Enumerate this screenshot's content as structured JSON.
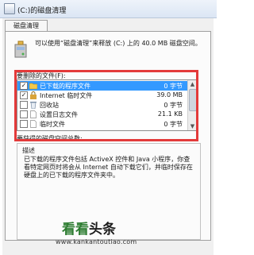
{
  "window": {
    "title": "(C:)的磁盘清理",
    "tab": "磁盘清理"
  },
  "intro": "可以使用“磁盘清理”来释放 (C:) 上的 40.0 MB 磁盘空间。",
  "group_label": "要删除的文件(F):",
  "files": [
    {
      "checked": true,
      "name": "已下载的程序文件",
      "size": "0 字节",
      "selected": true,
      "icon": "folder-icon"
    },
    {
      "checked": true,
      "name": "Internet 临时文件",
      "size": "39.0 MB",
      "selected": false,
      "icon": "lock-icon"
    },
    {
      "checked": false,
      "name": "回收站",
      "size": "0 字节",
      "selected": false,
      "icon": "recycle-bin-icon"
    },
    {
      "checked": false,
      "name": "设置日志文件",
      "size": "21.1 KB",
      "selected": false,
      "icon": "document-icon"
    },
    {
      "checked": false,
      "name": "临时文件",
      "size": "0 字节",
      "selected": false,
      "icon": "document-icon"
    }
  ],
  "total_label": "要获得的磁盘空间总数:",
  "description": {
    "title": "描述",
    "text": "已下载的程序文件包括 ActiveX 控件和 Java 小程序，你查看特定网页时将会从 Internet 自动下载它们，并临时保存在硬盘上的已下载的程序文件夹中。"
  },
  "watermark": {
    "logo_a": "看看",
    "logo_b": "头条",
    "url": "www.kankantoutiao.com"
  },
  "colors": {
    "selection": "#3399ff",
    "highlight_frame": "#e33a3a",
    "watermark_green": "#2e7d32"
  }
}
